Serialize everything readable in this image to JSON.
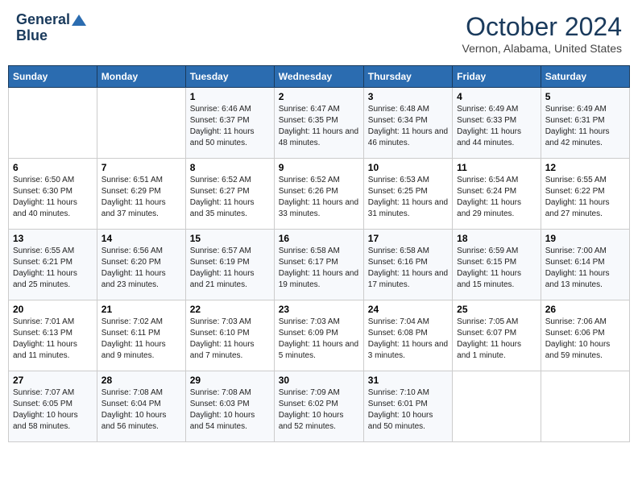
{
  "header": {
    "logo_line1": "General",
    "logo_line2": "Blue",
    "month": "October 2024",
    "location": "Vernon, Alabama, United States"
  },
  "weekdays": [
    "Sunday",
    "Monday",
    "Tuesday",
    "Wednesday",
    "Thursday",
    "Friday",
    "Saturday"
  ],
  "weeks": [
    [
      {
        "day": "",
        "info": ""
      },
      {
        "day": "",
        "info": ""
      },
      {
        "day": "1",
        "info": "Sunrise: 6:46 AM\nSunset: 6:37 PM\nDaylight: 11 hours and 50 minutes."
      },
      {
        "day": "2",
        "info": "Sunrise: 6:47 AM\nSunset: 6:35 PM\nDaylight: 11 hours and 48 minutes."
      },
      {
        "day": "3",
        "info": "Sunrise: 6:48 AM\nSunset: 6:34 PM\nDaylight: 11 hours and 46 minutes."
      },
      {
        "day": "4",
        "info": "Sunrise: 6:49 AM\nSunset: 6:33 PM\nDaylight: 11 hours and 44 minutes."
      },
      {
        "day": "5",
        "info": "Sunrise: 6:49 AM\nSunset: 6:31 PM\nDaylight: 11 hours and 42 minutes."
      }
    ],
    [
      {
        "day": "6",
        "info": "Sunrise: 6:50 AM\nSunset: 6:30 PM\nDaylight: 11 hours and 40 minutes."
      },
      {
        "day": "7",
        "info": "Sunrise: 6:51 AM\nSunset: 6:29 PM\nDaylight: 11 hours and 37 minutes."
      },
      {
        "day": "8",
        "info": "Sunrise: 6:52 AM\nSunset: 6:27 PM\nDaylight: 11 hours and 35 minutes."
      },
      {
        "day": "9",
        "info": "Sunrise: 6:52 AM\nSunset: 6:26 PM\nDaylight: 11 hours and 33 minutes."
      },
      {
        "day": "10",
        "info": "Sunrise: 6:53 AM\nSunset: 6:25 PM\nDaylight: 11 hours and 31 minutes."
      },
      {
        "day": "11",
        "info": "Sunrise: 6:54 AM\nSunset: 6:24 PM\nDaylight: 11 hours and 29 minutes."
      },
      {
        "day": "12",
        "info": "Sunrise: 6:55 AM\nSunset: 6:22 PM\nDaylight: 11 hours and 27 minutes."
      }
    ],
    [
      {
        "day": "13",
        "info": "Sunrise: 6:55 AM\nSunset: 6:21 PM\nDaylight: 11 hours and 25 minutes."
      },
      {
        "day": "14",
        "info": "Sunrise: 6:56 AM\nSunset: 6:20 PM\nDaylight: 11 hours and 23 minutes."
      },
      {
        "day": "15",
        "info": "Sunrise: 6:57 AM\nSunset: 6:19 PM\nDaylight: 11 hours and 21 minutes."
      },
      {
        "day": "16",
        "info": "Sunrise: 6:58 AM\nSunset: 6:17 PM\nDaylight: 11 hours and 19 minutes."
      },
      {
        "day": "17",
        "info": "Sunrise: 6:58 AM\nSunset: 6:16 PM\nDaylight: 11 hours and 17 minutes."
      },
      {
        "day": "18",
        "info": "Sunrise: 6:59 AM\nSunset: 6:15 PM\nDaylight: 11 hours and 15 minutes."
      },
      {
        "day": "19",
        "info": "Sunrise: 7:00 AM\nSunset: 6:14 PM\nDaylight: 11 hours and 13 minutes."
      }
    ],
    [
      {
        "day": "20",
        "info": "Sunrise: 7:01 AM\nSunset: 6:13 PM\nDaylight: 11 hours and 11 minutes."
      },
      {
        "day": "21",
        "info": "Sunrise: 7:02 AM\nSunset: 6:11 PM\nDaylight: 11 hours and 9 minutes."
      },
      {
        "day": "22",
        "info": "Sunrise: 7:03 AM\nSunset: 6:10 PM\nDaylight: 11 hours and 7 minutes."
      },
      {
        "day": "23",
        "info": "Sunrise: 7:03 AM\nSunset: 6:09 PM\nDaylight: 11 hours and 5 minutes."
      },
      {
        "day": "24",
        "info": "Sunrise: 7:04 AM\nSunset: 6:08 PM\nDaylight: 11 hours and 3 minutes."
      },
      {
        "day": "25",
        "info": "Sunrise: 7:05 AM\nSunset: 6:07 PM\nDaylight: 11 hours and 1 minute."
      },
      {
        "day": "26",
        "info": "Sunrise: 7:06 AM\nSunset: 6:06 PM\nDaylight: 10 hours and 59 minutes."
      }
    ],
    [
      {
        "day": "27",
        "info": "Sunrise: 7:07 AM\nSunset: 6:05 PM\nDaylight: 10 hours and 58 minutes."
      },
      {
        "day": "28",
        "info": "Sunrise: 7:08 AM\nSunset: 6:04 PM\nDaylight: 10 hours and 56 minutes."
      },
      {
        "day": "29",
        "info": "Sunrise: 7:08 AM\nSunset: 6:03 PM\nDaylight: 10 hours and 54 minutes."
      },
      {
        "day": "30",
        "info": "Sunrise: 7:09 AM\nSunset: 6:02 PM\nDaylight: 10 hours and 52 minutes."
      },
      {
        "day": "31",
        "info": "Sunrise: 7:10 AM\nSunset: 6:01 PM\nDaylight: 10 hours and 50 minutes."
      },
      {
        "day": "",
        "info": ""
      },
      {
        "day": "",
        "info": ""
      }
    ]
  ]
}
